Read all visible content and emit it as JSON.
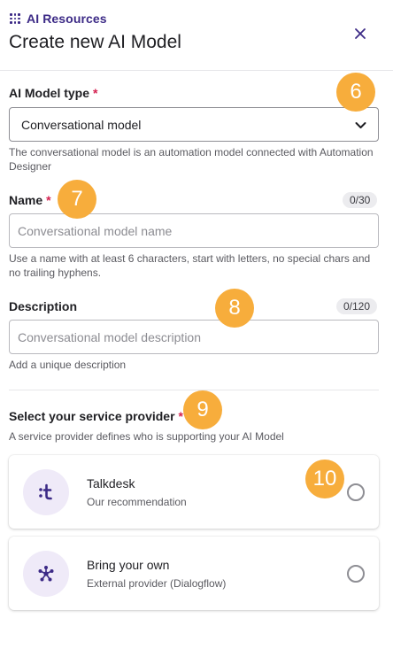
{
  "header": {
    "breadcrumb": "AI Resources",
    "title": "Create new AI Model",
    "close_icon": "close-icon"
  },
  "model_type": {
    "label": "AI Model type",
    "required_mark": "*",
    "value": "Conversational model",
    "help": "The conversational model is an automation model connected with Automation Designer"
  },
  "name": {
    "label": "Name",
    "required_mark": "*",
    "counter": "0/30",
    "placeholder": "Conversational model name",
    "help": "Use a name with at least 6 characters, start with letters, no special chars and no trailing hyphens."
  },
  "description": {
    "label": "Description",
    "counter": "0/120",
    "placeholder": "Conversational model description",
    "help": "Add a unique description"
  },
  "provider": {
    "label": "Select your service provider",
    "required_mark": "*",
    "help": "A service provider defines who is supporting your AI Model",
    "options": [
      {
        "name": "Talkdesk",
        "subtitle": "Our recommendation",
        "icon": "talkdesk-logo-icon",
        "selected": false
      },
      {
        "name": "Bring your own",
        "subtitle": "External provider (Dialogflow)",
        "icon": "dialogflow-network-icon",
        "selected": false
      }
    ]
  },
  "markers": [
    "6",
    "7",
    "8",
    "9",
    "10"
  ],
  "colors": {
    "brand": "#3c2a86",
    "required": "#d4204f",
    "marker": "#f7ad3c",
    "avatar_bg": "#efeaf8"
  }
}
